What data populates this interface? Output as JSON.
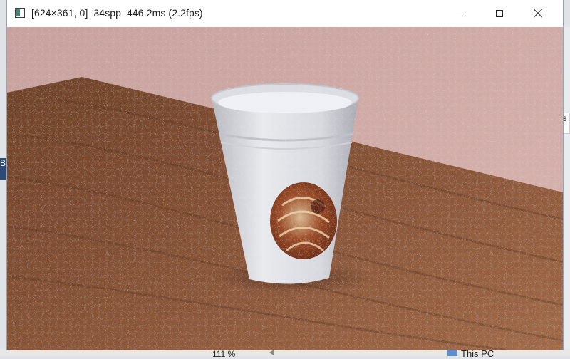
{
  "window": {
    "title": "[624×361, 0]  34spp  446.2ms (2.2fps)",
    "icon": "render-window-icon",
    "controls": [
      "minimize-icon",
      "maximize-icon",
      "close-icon"
    ]
  },
  "viewport": {
    "content": "rendered scene image",
    "colors": {
      "wall": "#c9a29e",
      "table": "#7a4a2e",
      "cup": "#dfe1e6",
      "shell": "#8a3a1f"
    }
  },
  "background": {
    "zoom_label": "111 %",
    "location_label": "This PC",
    "left_fragment": "B",
    "right_fragment": "is"
  }
}
